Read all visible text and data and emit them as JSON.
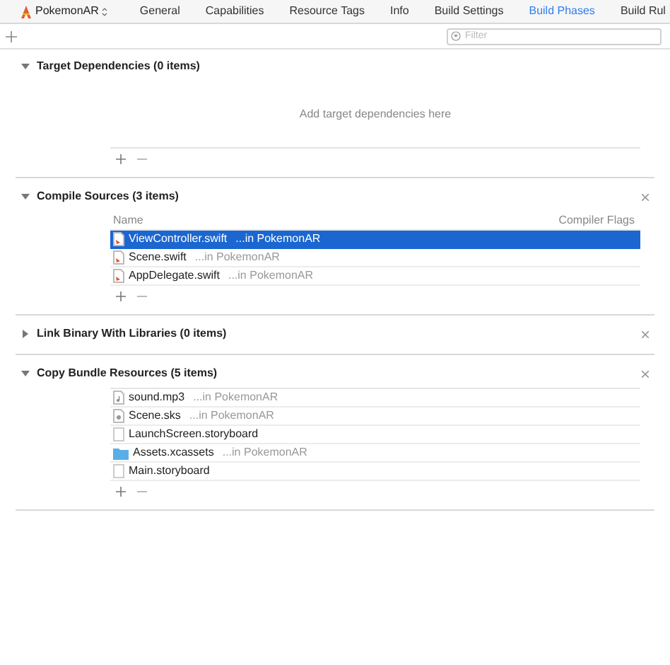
{
  "target": {
    "name": "PokemonAR"
  },
  "tabs": [
    {
      "label": "General",
      "selected": false
    },
    {
      "label": "Capabilities",
      "selected": false
    },
    {
      "label": "Resource Tags",
      "selected": false
    },
    {
      "label": "Info",
      "selected": false
    },
    {
      "label": "Build Settings",
      "selected": false
    },
    {
      "label": "Build Phases",
      "selected": true
    },
    {
      "label": "Build Rul",
      "selected": false
    }
  ],
  "filter": {
    "placeholder": "Filter"
  },
  "phases": [
    {
      "title": "Target Dependencies (0 items)",
      "expanded": true,
      "removable": false,
      "empty_message": "Add target dependencies here"
    },
    {
      "title": "Compile Sources (3 items)",
      "expanded": true,
      "removable": true,
      "columns": [
        "Name",
        "Compiler Flags"
      ],
      "files": [
        {
          "name": "ViewController.swift",
          "location": "...in PokemonAR",
          "kind": "swift",
          "selected": true
        },
        {
          "name": "Scene.swift",
          "location": "...in PokemonAR",
          "kind": "swift",
          "selected": false
        },
        {
          "name": "AppDelegate.swift",
          "location": "...in PokemonAR",
          "kind": "swift",
          "selected": false
        }
      ]
    },
    {
      "title": "Link Binary With Libraries (0 items)",
      "expanded": false,
      "removable": true
    },
    {
      "title": "Copy Bundle Resources (5 items)",
      "expanded": true,
      "removable": true,
      "files": [
        {
          "name": "sound.mp3",
          "location": "...in PokemonAR",
          "kind": "audio",
          "selected": false
        },
        {
          "name": "Scene.sks",
          "location": "...in PokemonAR",
          "kind": "scene",
          "selected": false
        },
        {
          "name": "LaunchScreen.storyboard",
          "kind": "storyboard",
          "selected": false
        },
        {
          "name": "Assets.xcassets",
          "location": "...in PokemonAR",
          "kind": "assets",
          "selected": false
        },
        {
          "name": "Main.storyboard",
          "kind": "storyboard",
          "selected": false
        }
      ]
    }
  ]
}
